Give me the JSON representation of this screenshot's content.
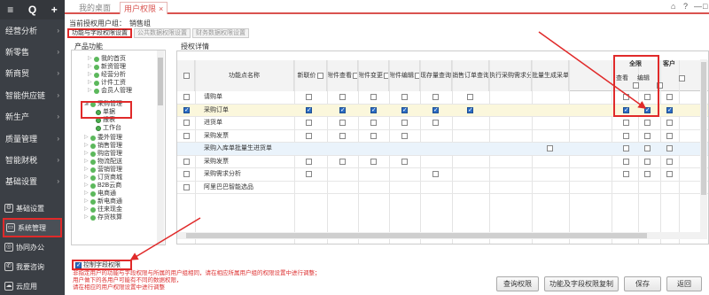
{
  "sidebar": {
    "top_icons": [
      "≡",
      "Q",
      "+"
    ],
    "items": [
      {
        "label": "经营分析"
      },
      {
        "label": "新零售"
      },
      {
        "label": "新商贸"
      },
      {
        "label": "智能供应链"
      },
      {
        "label": "新生产"
      },
      {
        "label": "质量管理"
      },
      {
        "label": "智能财税"
      },
      {
        "label": "基础设置"
      }
    ],
    "bottom_items": [
      {
        "label": "基础设置",
        "icon": "settings-icon"
      },
      {
        "label": "系统管理",
        "icon": "system-icon"
      },
      {
        "label": "协同办公",
        "icon": "collab-icon"
      },
      {
        "label": "我要咨询",
        "icon": "consult-icon"
      },
      {
        "label": "云应用",
        "icon": "cloud-icon"
      }
    ]
  },
  "tabs": {
    "desktop": "我的桌面",
    "rights": "用户权限",
    "close": "×",
    "win_buttons": [
      "⌂",
      "?",
      "—",
      "□",
      "×"
    ]
  },
  "userinfo": {
    "label": "当前授权用户组：",
    "value": "销售组"
  },
  "subtabs": [
    "功能与字段权限设置",
    "公共数据权限设置",
    "财务数据权限设置"
  ],
  "tree": {
    "title": "产品功能",
    "nodes": [
      {
        "label": "我的首页"
      },
      {
        "label": "新资管理"
      },
      {
        "label": "经营分析"
      },
      {
        "label": "计件工资"
      },
      {
        "label": "会员人管理"
      },
      {
        "label": "采购管理"
      },
      {
        "label": "单据"
      },
      {
        "label": "报表"
      },
      {
        "label": "工作台"
      },
      {
        "label": "委外管理"
      },
      {
        "label": "销售管理"
      },
      {
        "label": "购店管理"
      },
      {
        "label": "物流配送"
      },
      {
        "label": "营销管理"
      },
      {
        "label": "订货商城"
      },
      {
        "label": "B2B云商"
      },
      {
        "label": "电商通"
      },
      {
        "label": "新电商通"
      },
      {
        "label": "往来现金"
      },
      {
        "label": "存货核算"
      }
    ]
  },
  "detail": {
    "title": "授权详情",
    "head_func": "功能点名称",
    "columns": [
      "新联价",
      "附件查看",
      "附件变更",
      "附件编辑",
      "现存量查询",
      "销售订单查询",
      "执行采购需求分析",
      "批量生成采单"
    ],
    "all_group": "全限",
    "all_sub": [
      "查看",
      "编辑"
    ],
    "cust_group": "客户",
    "rows": [
      {
        "name": "请购单"
      },
      {
        "name": "采购订单"
      },
      {
        "name": "进货单"
      },
      {
        "name": "采购发票"
      },
      {
        "name": "采购入库单批量生进货单"
      },
      {
        "name": "采购发票"
      },
      {
        "name": "采购需求分析"
      },
      {
        "name": "阿里巴巴智能选品"
      }
    ]
  },
  "bottom": {
    "ctrl_label": "控制字段权限",
    "notes": [
      "非指定用户的功能与字段权限与所属的用户组相同，请在相应所属用户组的权限设置中进行调整；",
      "用户做下的各用户可能有不同的数据权限，",
      "请在相应的用户权限设置中进行调整"
    ],
    "buttons": [
      "查询权限",
      "功能及字段权限复制",
      "保存",
      "返回"
    ]
  },
  "colors": {
    "accent": "#d9534f",
    "annotation": "#e02a2a",
    "checked": "#2b6cc4",
    "sidebar": "#3b3f45"
  }
}
